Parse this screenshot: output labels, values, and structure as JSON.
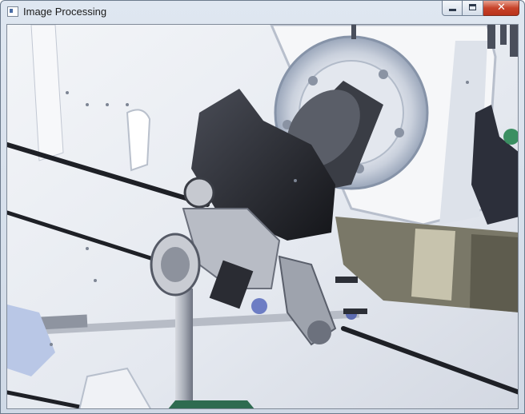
{
  "window": {
    "title": "Image Processing",
    "icon": "window-app-icon",
    "controls": {
      "minimize_icon": "minimize-icon",
      "maximize_icon": "maximize-icon",
      "close_icon": "close-icon",
      "close_glyph": "✕"
    },
    "close_color": "#c7432a"
  },
  "image": {
    "content": "inverted-color camera frame of a robotic arm wrist joint against a spacecraft panel"
  }
}
